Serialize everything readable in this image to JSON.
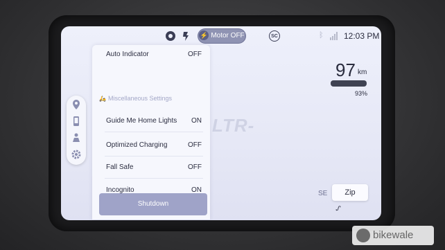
{
  "status_bar": {
    "motor_label": "Motor OFF",
    "sc_badge": "SC",
    "time": "12:03 PM"
  },
  "left_rail": {
    "items": [
      "location-icon",
      "phone-icon",
      "rider-icon",
      "gear-icon"
    ]
  },
  "settings_panel": {
    "auto_indicator": {
      "label": "Auto Indicator",
      "value": "OFF"
    },
    "section_header": "Miscellaneous Settings",
    "rows": [
      {
        "label": "Guide Me Home Lights",
        "value": "ON"
      },
      {
        "label": "Optimized Charging",
        "value": "OFF"
      },
      {
        "label": "Fall Safe",
        "value": "OFF"
      },
      {
        "label": "Incognito",
        "value": "ON"
      }
    ],
    "shutdown_label": "Shutdown"
  },
  "watermark": "LTR-",
  "range": {
    "value": "97",
    "unit": "km",
    "battery_percent": "93%",
    "battery_fraction": 0.93
  },
  "ride_mode": {
    "left": "SE",
    "selected": "Zip",
    "mark": "ᔑ"
  },
  "corner_logo": {
    "text": "bikewale"
  },
  "colors": {
    "accent": "#9fa3c8",
    "screen_bg": "#e6e8f6",
    "text": "#2a2c3e"
  }
}
